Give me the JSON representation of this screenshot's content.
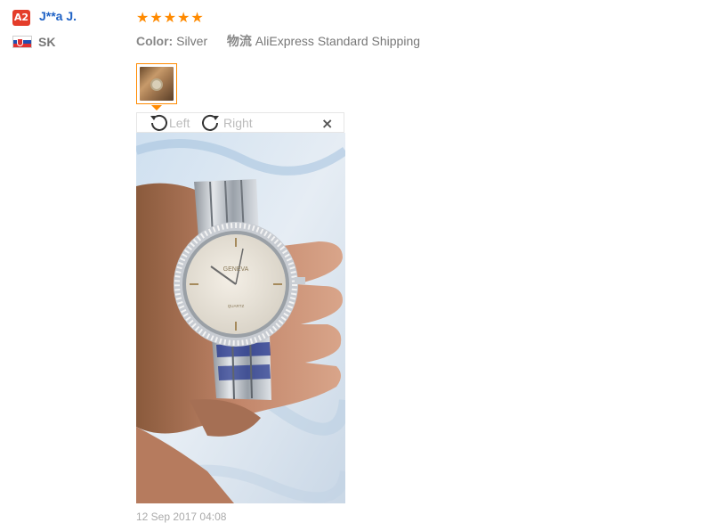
{
  "reviewer": {
    "level_badge": "A2",
    "name": "J**a J.",
    "country": "SK",
    "flag_icon": "slovakia-flag-icon"
  },
  "review": {
    "rating": 5,
    "rating_max": 5,
    "color_label": "Color:",
    "color_value": "Silver",
    "shipping_label": "物流",
    "shipping_value": "AliExpress Standard Shipping",
    "date": "12 Sep 2017 04:08"
  },
  "viewer": {
    "rotate_left_label": "Left",
    "rotate_right_label": "Right",
    "close_symbol": "×",
    "watch_brand": "GENEVA",
    "watch_sub": "QUARTZ"
  },
  "colors": {
    "accent": "#ff8a00",
    "link": "#1f62c5",
    "badge": "#e43d2a"
  }
}
